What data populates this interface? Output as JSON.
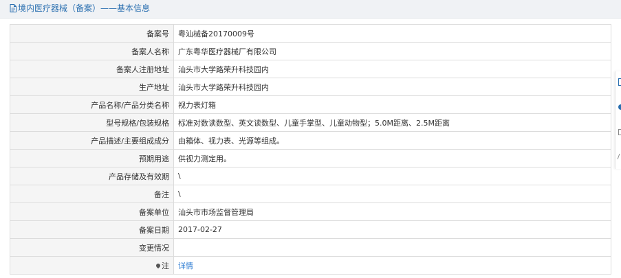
{
  "header": {
    "title": "境内医疗器械（备案）——基本信息"
  },
  "rows": [
    {
      "label": "备案号",
      "value": "粤汕械备20170009号"
    },
    {
      "label": "备案人名称",
      "value": "广东粤华医疗器械厂有限公司"
    },
    {
      "label": "备案人注册地址",
      "value": "汕头市大学路荣升科技园内"
    },
    {
      "label": "生产地址",
      "value": "汕头市大学路荣升科技园内"
    },
    {
      "label": "产品名称/产品分类名称",
      "value": "视力表灯箱"
    },
    {
      "label": "型号规格/包装规格",
      "value": "标准对数读数型、英文读数型、儿童手掌型、儿童动物型；5.0M距离、2.5M距离"
    },
    {
      "label": "产品描述/主要组成成分",
      "value": "由箱体、视力表、光源等组成。"
    },
    {
      "label": "预期用途",
      "value": "供视力测定用。"
    },
    {
      "label": "产品存储及有效期",
      "value": "\\"
    },
    {
      "label": "备注",
      "value": "\\"
    },
    {
      "label": "备案单位",
      "value": "汕头市市场监督管理局"
    },
    {
      "label": "备案日期",
      "value": "2017-02-27"
    },
    {
      "label": "变更情况",
      "value": ""
    }
  ],
  "note_row": {
    "label": "注",
    "link_text": "详情"
  },
  "colors": {
    "accent": "#2a6fb0",
    "link": "#2a7ad2",
    "label_bg": "#f5f5f5",
    "border": "#dcdcdc"
  }
}
